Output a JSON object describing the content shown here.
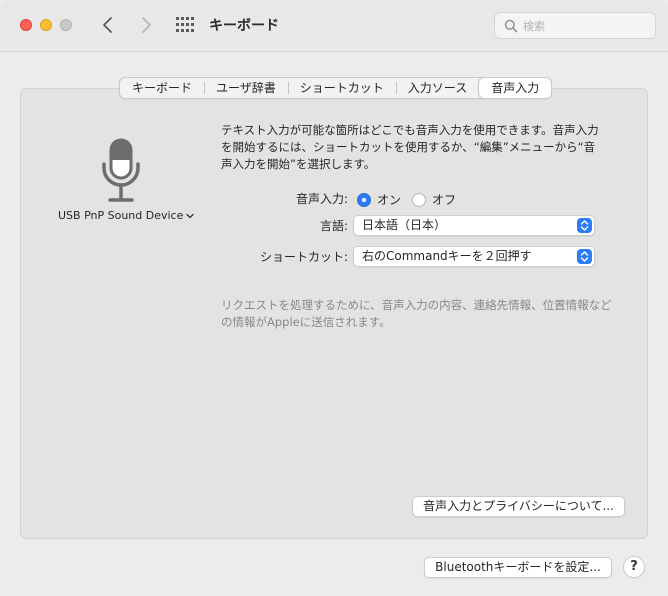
{
  "window": {
    "title": "キーボード"
  },
  "search": {
    "placeholder": "検索"
  },
  "tabs": [
    {
      "label": "キーボード",
      "active": false
    },
    {
      "label": "ユーザ辞書",
      "active": false
    },
    {
      "label": "ショートカット",
      "active": false
    },
    {
      "label": "入力ソース",
      "active": false
    },
    {
      "label": "音声入力",
      "active": true
    }
  ],
  "dictation": {
    "device": "USB PnP Sound Device",
    "description": "テキスト入力が可能な箇所はどこでも音声入力を使用できます。音声入力を開始するには、ショートカットを使用するか、“編集”メニューから“音声入力を開始”を選択します。",
    "toggle_label": "音声入力:",
    "on_label": "オン",
    "off_label": "オフ",
    "language_label": "言語:",
    "language_value": "日本語（日本）",
    "shortcut_label": "ショートカット:",
    "shortcut_value": "右のCommandキーを２回押す",
    "privacy_note": "リクエストを処理するために、音声入力の内容、連絡先情報、位置情報などの情報がAppleに送信されます。",
    "privacy_button": "音声入力とプライバシーについて..."
  },
  "footer": {
    "bluetooth_button": "Bluetoothキーボードを設定...",
    "help_label": "?"
  },
  "colors": {
    "accent": "#2e7cf6",
    "close": "#ff5f57",
    "minimize": "#febc2e",
    "maximize": "#c8c8c8"
  }
}
